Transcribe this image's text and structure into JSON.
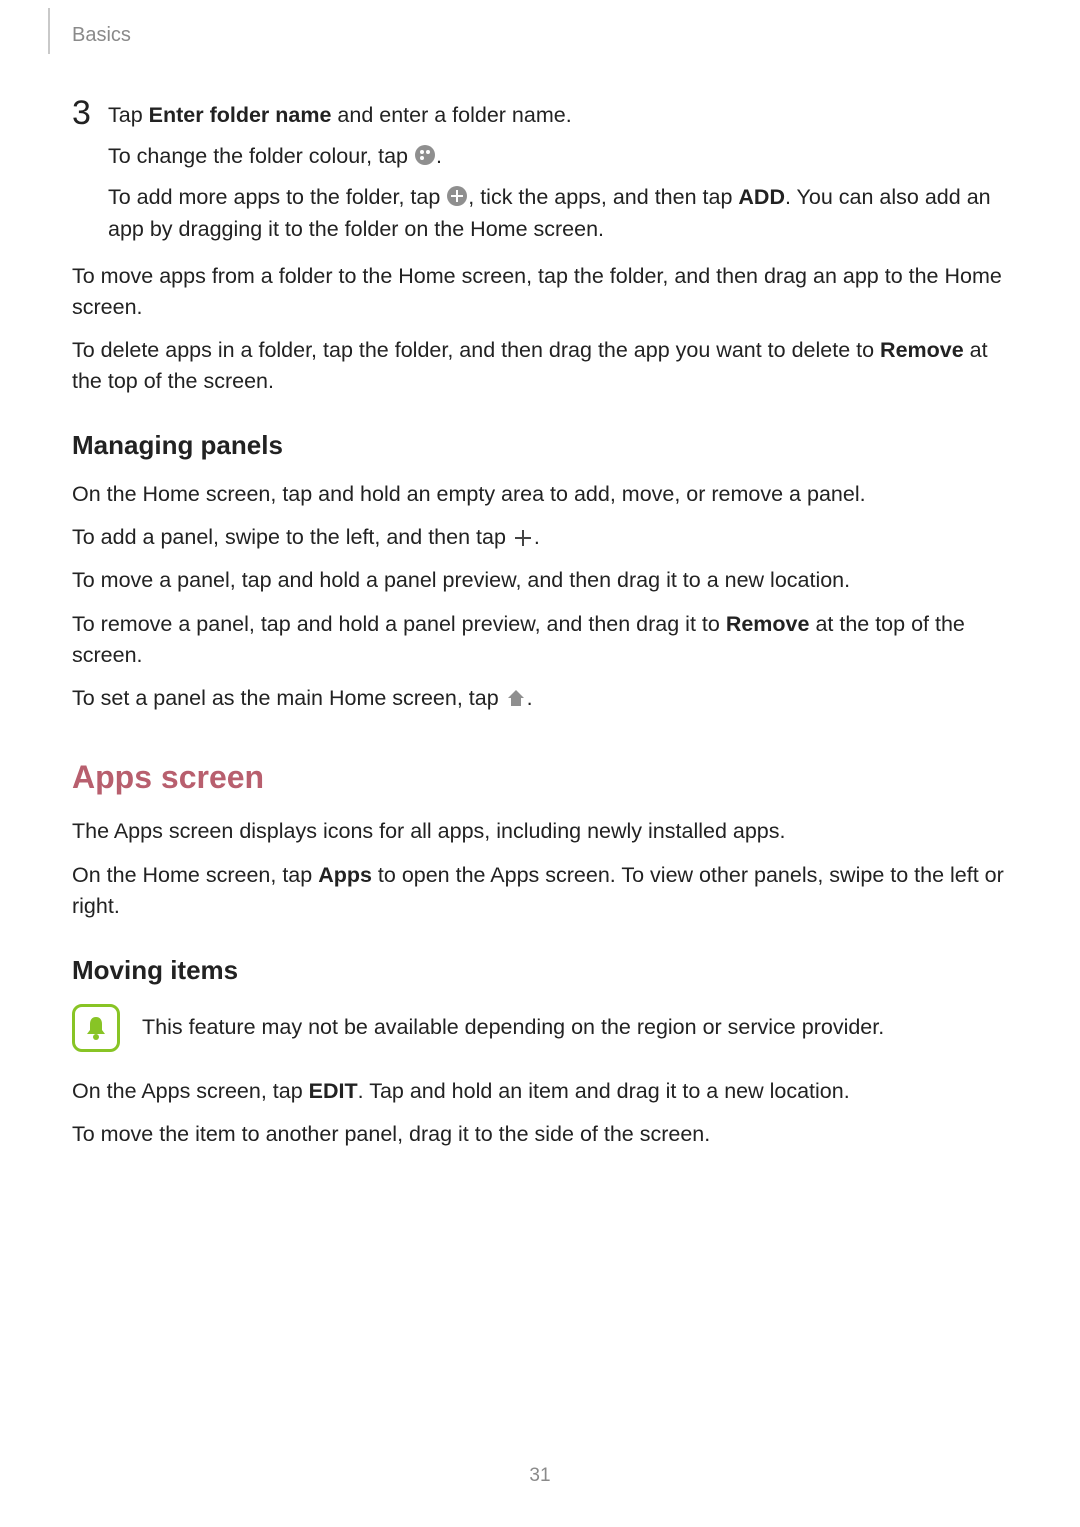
{
  "chapter": "Basics",
  "pageNumber": "31",
  "step3": {
    "num": "3",
    "line1_a": "Tap ",
    "line1_b": "Enter folder name",
    "line1_c": " and enter a folder name.",
    "line2_a": "To change the folder colour, tap ",
    "line2_b": ".",
    "line3_a": "To add more apps to the folder, tap ",
    "line3_b": ", tick the apps, and then tap ",
    "line3_c": "ADD",
    "line3_d": ". You can also add an app by dragging it to the folder on the Home screen."
  },
  "folderMovePara": "To move apps from a folder to the Home screen, tap the folder, and then drag an app to the Home screen.",
  "folderDelete_a": "To delete apps in a folder, tap the folder, and then drag the app you want to delete to ",
  "folderDelete_b": "Remove",
  "folderDelete_c": " at the top of the screen.",
  "managingPanels": {
    "title": "Managing panels",
    "p1": "On the Home screen, tap and hold an empty area to add, move, or remove a panel.",
    "p2_a": "To add a panel, swipe to the left, and then tap ",
    "p2_b": ".",
    "p3": "To move a panel, tap and hold a panel preview, and then drag it to a new location.",
    "p4_a": "To remove a panel, tap and hold a panel preview, and then drag it to ",
    "p4_b": "Remove",
    "p4_c": " at the top of the screen.",
    "p5_a": "To set a panel as the main Home screen, tap ",
    "p5_b": "."
  },
  "appsScreen": {
    "title": "Apps screen",
    "p1": "The Apps screen displays icons for all apps, including newly installed apps.",
    "p2_a": "On the Home screen, tap ",
    "p2_b": "Apps",
    "p2_c": " to open the Apps screen. To view other panels, swipe to the left or right."
  },
  "movingItems": {
    "title": "Moving items",
    "note": "This feature may not be available depending on the region or service provider.",
    "p1_a": "On the Apps screen, tap ",
    "p1_b": "EDIT",
    "p1_c": ". Tap and hold an item and drag it to a new location.",
    "p2": "To move the item to another panel, drag it to the side of the screen."
  }
}
